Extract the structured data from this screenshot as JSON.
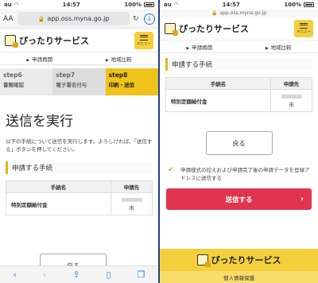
{
  "status": {
    "carrier": "au",
    "time": "14:57",
    "battery": "100%"
  },
  "left": {
    "browser": {
      "aa": "AA",
      "url": "app.oss.myna.go.jp"
    },
    "steps": [
      {
        "num": "step6",
        "label": "書類確認"
      },
      {
        "num": "step7",
        "label": "電子署名付与"
      },
      {
        "num": "step8",
        "label": "印刷・送信"
      }
    ],
    "page_title": "送信を実行",
    "intro": "以下の手続について送信を実行します。よろしければ、「送信する」ボタンを押してください。",
    "section_heading": "申請する手続",
    "table": {
      "headers": [
        "手続名",
        "申請先"
      ],
      "row": {
        "name": "特別定額給付金",
        "city": "市"
      }
    },
    "partial_button": "戻る"
  },
  "right": {
    "browser": {
      "url": "app.oss.myna.go.jp"
    },
    "section_heading": "申請する手続",
    "table": {
      "headers": [
        "手続名",
        "申請先"
      ],
      "row": {
        "name": "特別定額給付金",
        "city": "市"
      }
    },
    "back_button": "戻る",
    "checkbox_label": "申請様式の控えおよび申請完了後の申請データを登録アドレスに送信する",
    "send_button": "送信する",
    "footer_logo": "ぴったりサービス",
    "footer_link": "個人情報保護"
  },
  "header": {
    "logo_text": "ぴったりサービス",
    "menu_label": "メニュー"
  },
  "subnav": [
    "申請再開",
    "地域比較"
  ],
  "colors": {
    "accent_yellow": "#f0c21b",
    "send_red": "#e0344f",
    "ios_blue": "#2a7ee3"
  },
  "icons": [
    "lock-icon",
    "reload-icon",
    "download-icon",
    "menu-icon",
    "back-arrow-icon",
    "forward-arrow-icon",
    "share-icon",
    "bookmarks-icon",
    "tabs-icon",
    "checkmark-icon",
    "chevron-right-icon"
  ]
}
